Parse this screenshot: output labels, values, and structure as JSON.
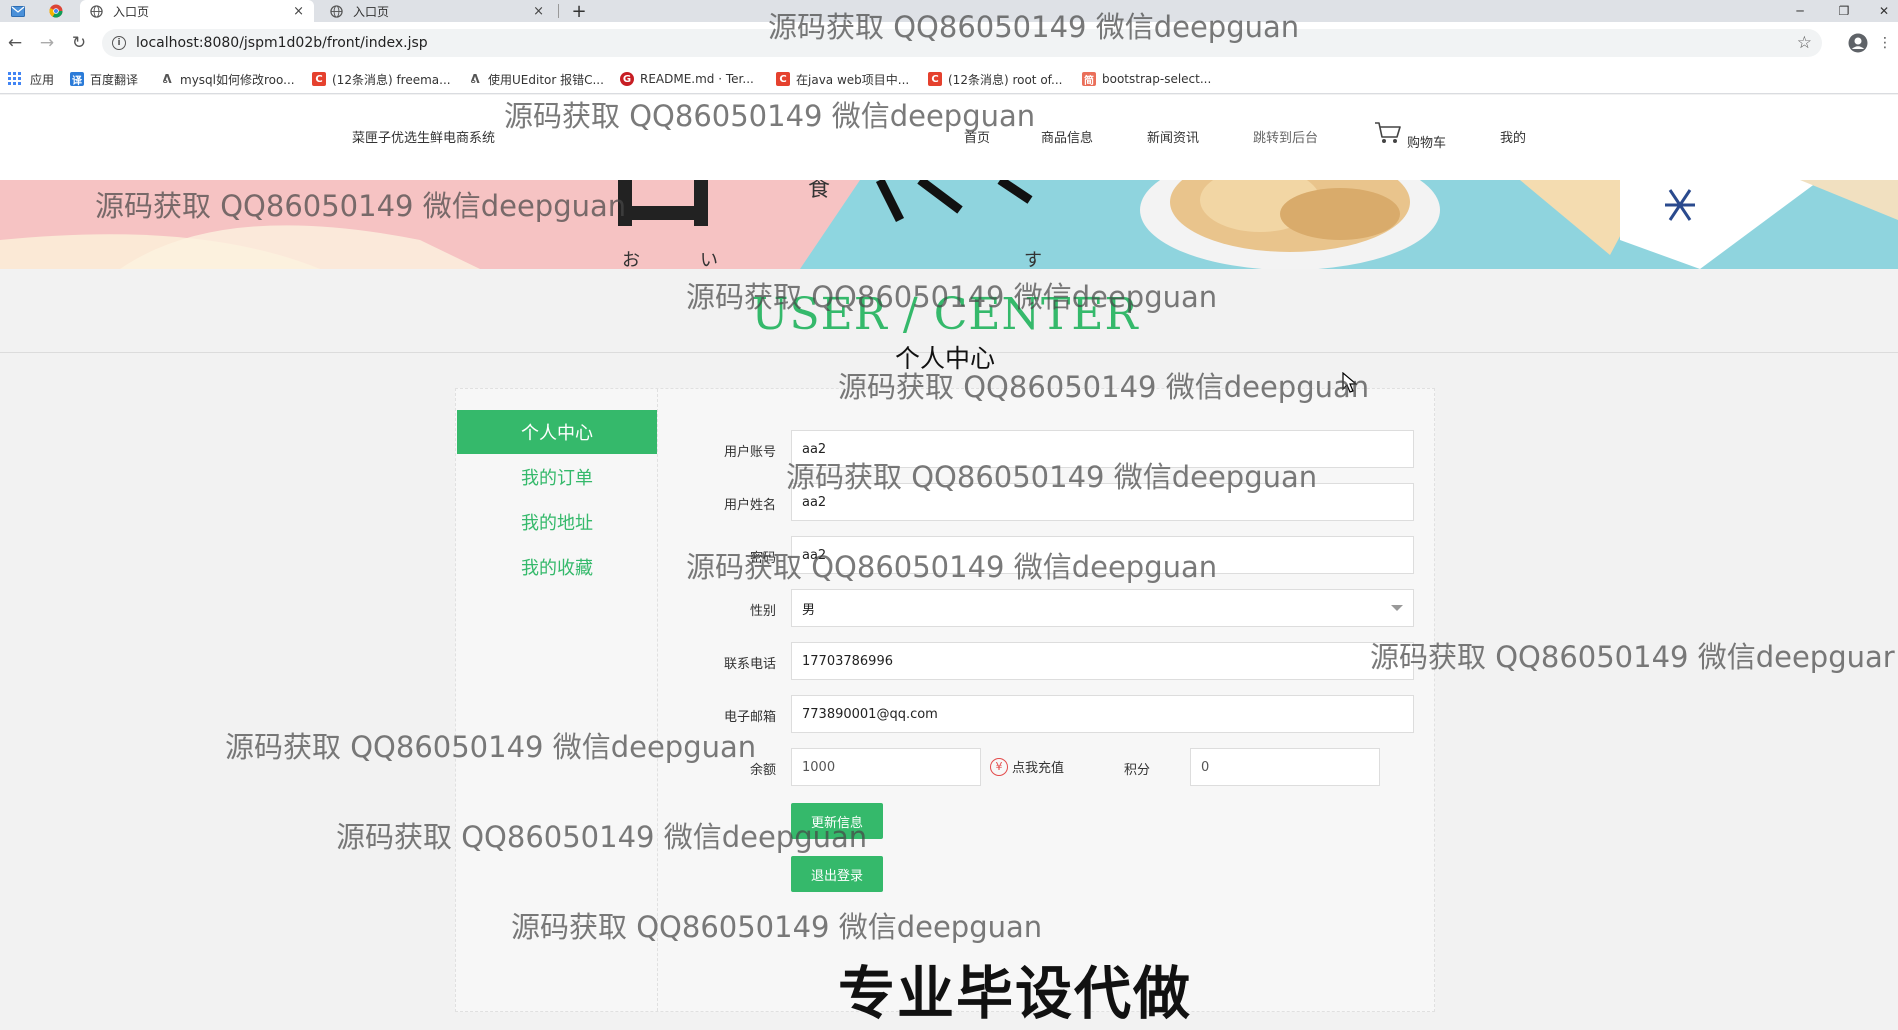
{
  "browser": {
    "tabs": [
      {
        "title": "入口页",
        "close": "×"
      },
      {
        "title": "入口页",
        "close": "×"
      }
    ],
    "new_tab": "+",
    "window_controls": {
      "minimize": "─",
      "restore": "❐",
      "close": "✕"
    },
    "url": "localhost:8080/jspm1d02b/front/index.jsp",
    "bookmarks": [
      {
        "label": "应用",
        "icon": "apps-grid-icon",
        "color": "#4285f4"
      },
      {
        "label": "百度翻译",
        "icon": "baidu-translate-icon",
        "color": "#2b7bd8"
      },
      {
        "label": "mysql如何修改roo...",
        "icon": "mysql-icon",
        "color": "#555555"
      },
      {
        "label": "(12条消息) freema...",
        "icon": "csdn-icon",
        "color": "#e5412e"
      },
      {
        "label": "使用UEditor 报错C...",
        "icon": "ueditor-icon",
        "color": "#555555"
      },
      {
        "label": "README.md · Ter...",
        "icon": "gitee-icon",
        "color": "#c71d23"
      },
      {
        "label": "在java web项目中...",
        "icon": "csdn-icon",
        "color": "#e5412e"
      },
      {
        "label": "(12条消息) root of...",
        "icon": "csdn-icon",
        "color": "#e5412e"
      },
      {
        "label": "bootstrap-select...",
        "icon": "jianshu-icon",
        "color": "#ea6f5a"
      }
    ]
  },
  "site": {
    "logo": "菜匣子优选生鲜电商系统",
    "nav": [
      {
        "label": "首页"
      },
      {
        "label": "商品信息"
      },
      {
        "label": "新闻资讯"
      },
      {
        "label": "跳转到后台"
      },
      {
        "label": "购物车"
      },
      {
        "label": "我的"
      }
    ],
    "accent_color": "#35b96b"
  },
  "heading": {
    "en": "USER / CENTER",
    "cn": "个人中心"
  },
  "sidebar": {
    "items": [
      {
        "label": "个人中心",
        "active": true
      },
      {
        "label": "我的订单"
      },
      {
        "label": "我的地址"
      },
      {
        "label": "我的收藏"
      }
    ]
  },
  "form": {
    "account": {
      "label": "用户账号",
      "value": "aa2"
    },
    "name": {
      "label": "用户姓名",
      "value": "aa2"
    },
    "password": {
      "label": "密码",
      "value": "aa2"
    },
    "gender": {
      "label": "性别",
      "value": "男"
    },
    "phone": {
      "label": "联系电话",
      "value": "17703786996"
    },
    "email": {
      "label": "电子邮箱",
      "value": "773890001@qq.com"
    },
    "balance": {
      "label": "余额",
      "value": "1000"
    },
    "recharge": {
      "label": "点我充值",
      "icon": "yen-icon"
    },
    "points": {
      "label": "积分",
      "value": "0"
    },
    "update_button": "更新信息",
    "logout_button": "退出登录"
  },
  "watermarks": {
    "text": "源码获取 QQ86050149 微信deepguan",
    "text_right": "源码获取 QQ86050149 微信deepguar",
    "bottom_ad": "专业毕设代做"
  }
}
